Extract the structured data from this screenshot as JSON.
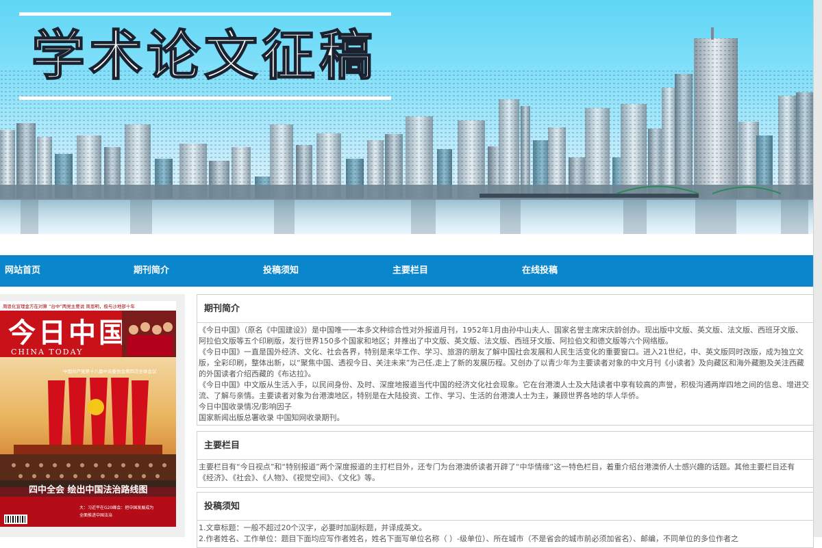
{
  "banner": {
    "title": "学术论文征稿"
  },
  "nav": {
    "items": [
      {
        "label": "网站首页"
      },
      {
        "label": "期刊简介"
      },
      {
        "label": "投稿须知"
      },
      {
        "label": "主要栏目"
      },
      {
        "label": "在线投稿"
      }
    ]
  },
  "cover": {
    "top_line": "周恩化宣理金方在对算 “台中”两党主要说 周恩明，极与沙地部十年",
    "logo_cn": "今日中国",
    "logo_en": "CHINA TODAY",
    "banner_text": "中国共产党第十八届中央委员会第四次全体会议",
    "headline": "四中全会 绘出中国法治路线图",
    "footer_line1": "大：习近平在G20峰会：把中国发展成为",
    "footer_line2": "全面推进中国法治"
  },
  "panels": [
    {
      "title": "期刊简介",
      "paragraphs": [
        "《今日中国》（原名《中国建设》）是中国唯一一本多文种综合性对外报道月刊，1952年1月由孙中山夫人、国家名誉主席宋庆龄创办。现出版中文版、英文版、法文版、西班牙文版、阿拉伯文版等五个印刷版，发行世界150多个国家和地区；并推出了中文版、英文版、法文版、西班牙文版、阿拉伯文和德文版等六个网络版。",
        "《今日中国》一直是国外经济、文化、社会各界，特别是来华工作、学习、旅游的朋友了解中国社会发展和人民生活变化的重要窗口。进入21世纪，中、英文版同时改版，成为独立文版，全彩印刷，整体出新，以“聚焦中国、透视今日、关注未来”为己任,走上了新的发展历程。又创办了以青少年为主要读者对象的中文月刊《小读者》及向藏区和海外藏胞及关注西藏的外国读者介绍西藏的《布达拉》。",
        "《今日中国》中文版从生活入手，以民间身份、及时、深度地报道当代中国的经济文化社会现象。它在台港澳人士及大陆读者中享有较高的声誉，积极沟通两岸四地之间的信息、增进交流、了解与亲情。主要读者对象为台港澳地区，特别是在大陆投资、工作、学习、生活的台港澳人士为主，兼顾世界各地的华人华侨。",
        "今日中国收录情况/影响因子",
        "国家新闻出版总署收录    中国知网收录期刊。"
      ]
    },
    {
      "title": "主要栏目",
      "paragraphs": [
        "主要栏目有“今日视点”和“特别报道”两个深度报道的主打栏目外，还专门为台港澳侨读者开辟了“中华情缘”这一特色栏目，着重介绍台港澳侨人士感兴趣的话题。其他主要栏目还有《经济》、《社会》、《人物》、《视觉空间》、《文化》等。"
      ]
    },
    {
      "title": "投稿须知",
      "paragraphs": [
        "1.文章标题：一般不超过20个汉字，必要时加副标题，并译成英文。",
        "2.作者姓名、工作单位：题目下面均应写作者姓名，姓名下面写单位名称（    ）-级单位）、所在城市（不是省会的城市前必须加省名）、邮编，不同单位的多位作者之"
      ]
    }
  ]
}
